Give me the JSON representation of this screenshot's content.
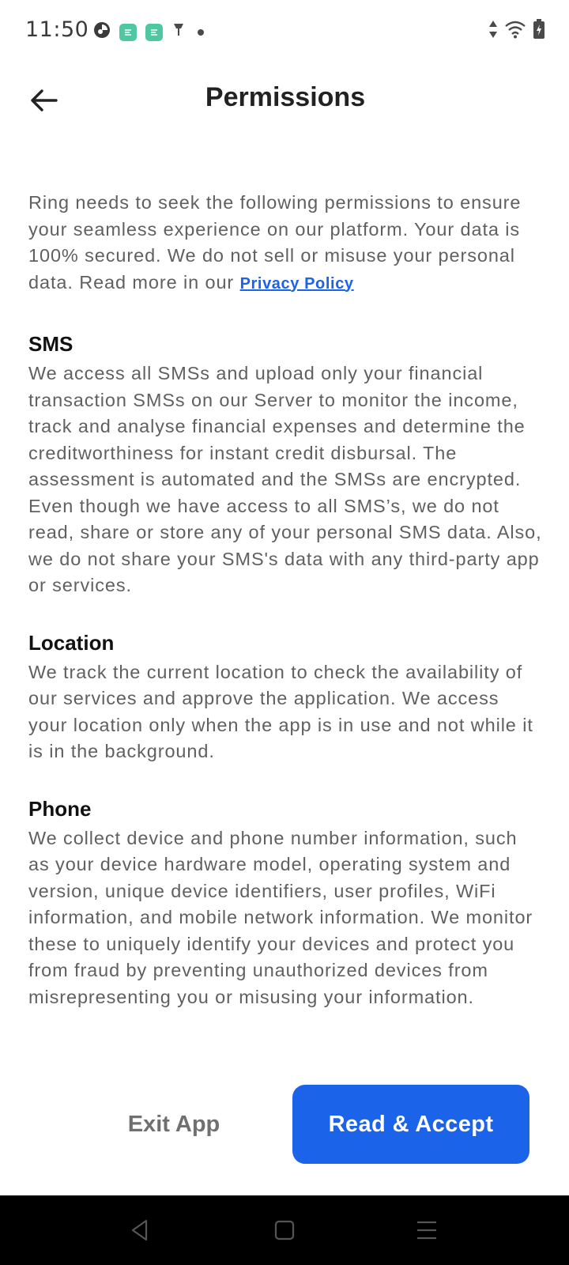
{
  "status_bar": {
    "time": "11:50",
    "icons": [
      "app-circle-icon",
      "app-green-square-icon",
      "app-green-square-icon",
      "vpn-key-icon",
      "notification-dot-icon",
      "data-arrows-icon",
      "wifi-icon",
      "battery-charging-icon"
    ]
  },
  "header": {
    "back_icon": "arrow-left-icon",
    "title": "Permissions"
  },
  "intro": {
    "text": "Ring needs to seek the following permissions to ensure your seamless experience on our platform. Your data is 100% secured. We do not sell or misuse your personal data. Read more in our ",
    "link_label": "Privacy Policy"
  },
  "sections": [
    {
      "title": "SMS",
      "body": "We access all SMSs and upload only your financial transaction SMSs on our Server to monitor the income, track and analyse financial expenses and determine the creditworthiness for instant credit disbursal. The assessment is automated and the SMSs are encrypted. Even though we have access to all SMS’s, we do not read, share or store any of your personal SMS data. Also, we do not share your SMS's data with any third-party app or services."
    },
    {
      "title": "Location",
      "body": "We track the current location to check the availability of our services and approve the application. We access your location only when the app is in use and not while it is in the background."
    },
    {
      "title": "Phone",
      "body": "We collect device and phone number information, such as your device hardware model, operating system and version, unique device identifiers, user profiles, WiFi information, and mobile network information. We monitor these to uniquely identify your devices and protect you from fraud by preventing unauthorized devices from misrepresenting you or misusing your information."
    }
  ],
  "actions": {
    "exit_label": "Exit App",
    "accept_label": "Read & Accept"
  },
  "nav_bar": {
    "icons": [
      "nav-back-icon",
      "nav-home-icon",
      "nav-menu-icon"
    ]
  },
  "colors": {
    "accent": "#1b63e8",
    "body_text": "#606060",
    "heading_text": "#111111",
    "nav_bar_bg": "#000000"
  }
}
